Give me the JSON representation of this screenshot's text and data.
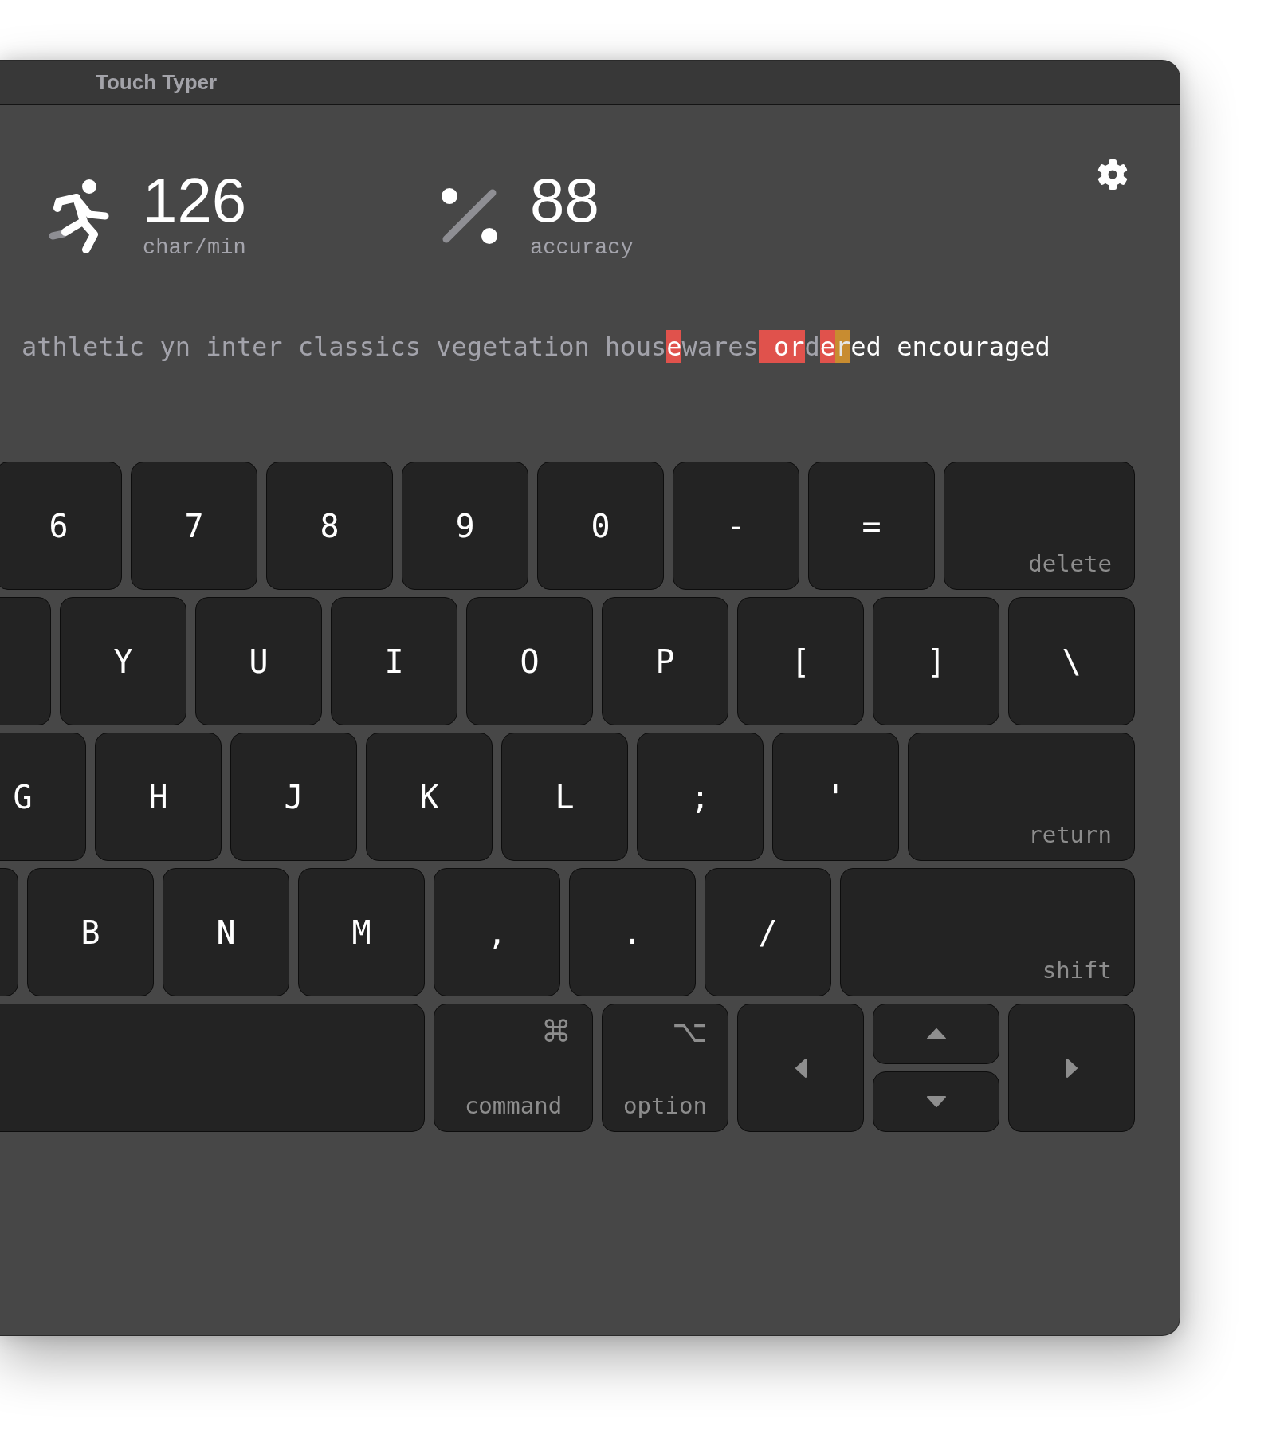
{
  "window": {
    "title": "Touch Typer"
  },
  "stats": [
    {
      "kind": "speed",
      "value": "126",
      "label": "char/min"
    },
    {
      "kind": "accuracy",
      "value": "88",
      "label": "accuracy"
    }
  ],
  "typing_text": [
    {
      "text": "athletic yn inter classics vegetation hous",
      "kind": "typed"
    },
    {
      "text": "e",
      "kind": "error"
    },
    {
      "text": "wares",
      "kind": "typed"
    },
    {
      "text": " or",
      "kind": "error"
    },
    {
      "text": "d",
      "kind": "typed"
    },
    {
      "text": "e",
      "kind": "error"
    },
    {
      "text": "r",
      "kind": "current"
    },
    {
      "text": "ed encouraged",
      "kind": "pending"
    }
  ],
  "keyboard": {
    "rows": [
      {
        "keys": [
          {
            "kind": "char",
            "label": "6"
          },
          {
            "kind": "char",
            "label": "7"
          },
          {
            "kind": "char",
            "label": "8"
          },
          {
            "kind": "char",
            "label": "9"
          },
          {
            "kind": "char",
            "label": "0"
          },
          {
            "kind": "char",
            "label": "-"
          },
          {
            "kind": "char",
            "label": "="
          },
          {
            "kind": "delete",
            "label": "delete"
          }
        ]
      },
      {
        "keys": [
          {
            "kind": "blank"
          },
          {
            "kind": "char",
            "label": "Y"
          },
          {
            "kind": "char",
            "label": "U"
          },
          {
            "kind": "char",
            "label": "I"
          },
          {
            "kind": "char",
            "label": "O"
          },
          {
            "kind": "char",
            "label": "P"
          },
          {
            "kind": "char",
            "label": "["
          },
          {
            "kind": "char",
            "label": "]"
          },
          {
            "kind": "char",
            "label": "\\"
          }
        ]
      },
      {
        "keys": [
          {
            "kind": "char",
            "label": "G"
          },
          {
            "kind": "char",
            "label": "H"
          },
          {
            "kind": "char",
            "label": "J"
          },
          {
            "kind": "char",
            "label": "K"
          },
          {
            "kind": "char",
            "label": "L"
          },
          {
            "kind": "char",
            "label": ";"
          },
          {
            "kind": "char",
            "label": "'"
          },
          {
            "kind": "return",
            "label": "return"
          }
        ]
      },
      {
        "keys": [
          {
            "kind": "blank"
          },
          {
            "kind": "char",
            "label": "B"
          },
          {
            "kind": "char",
            "label": "N"
          },
          {
            "kind": "char",
            "label": "M"
          },
          {
            "kind": "char",
            "label": ","
          },
          {
            "kind": "char",
            "label": "."
          },
          {
            "kind": "char",
            "label": "/"
          },
          {
            "kind": "shift",
            "label": "shift"
          }
        ]
      },
      {
        "keys": [
          {
            "kind": "space"
          },
          {
            "kind": "command",
            "symbol": "⌘",
            "label": "command"
          },
          {
            "kind": "option",
            "symbol": "⌥",
            "label": "option"
          },
          {
            "kind": "left"
          },
          {
            "kind": "stack",
            "keys": [
              {
                "kind": "up"
              },
              {
                "kind": "down"
              }
            ]
          },
          {
            "kind": "right"
          }
        ]
      }
    ]
  }
}
